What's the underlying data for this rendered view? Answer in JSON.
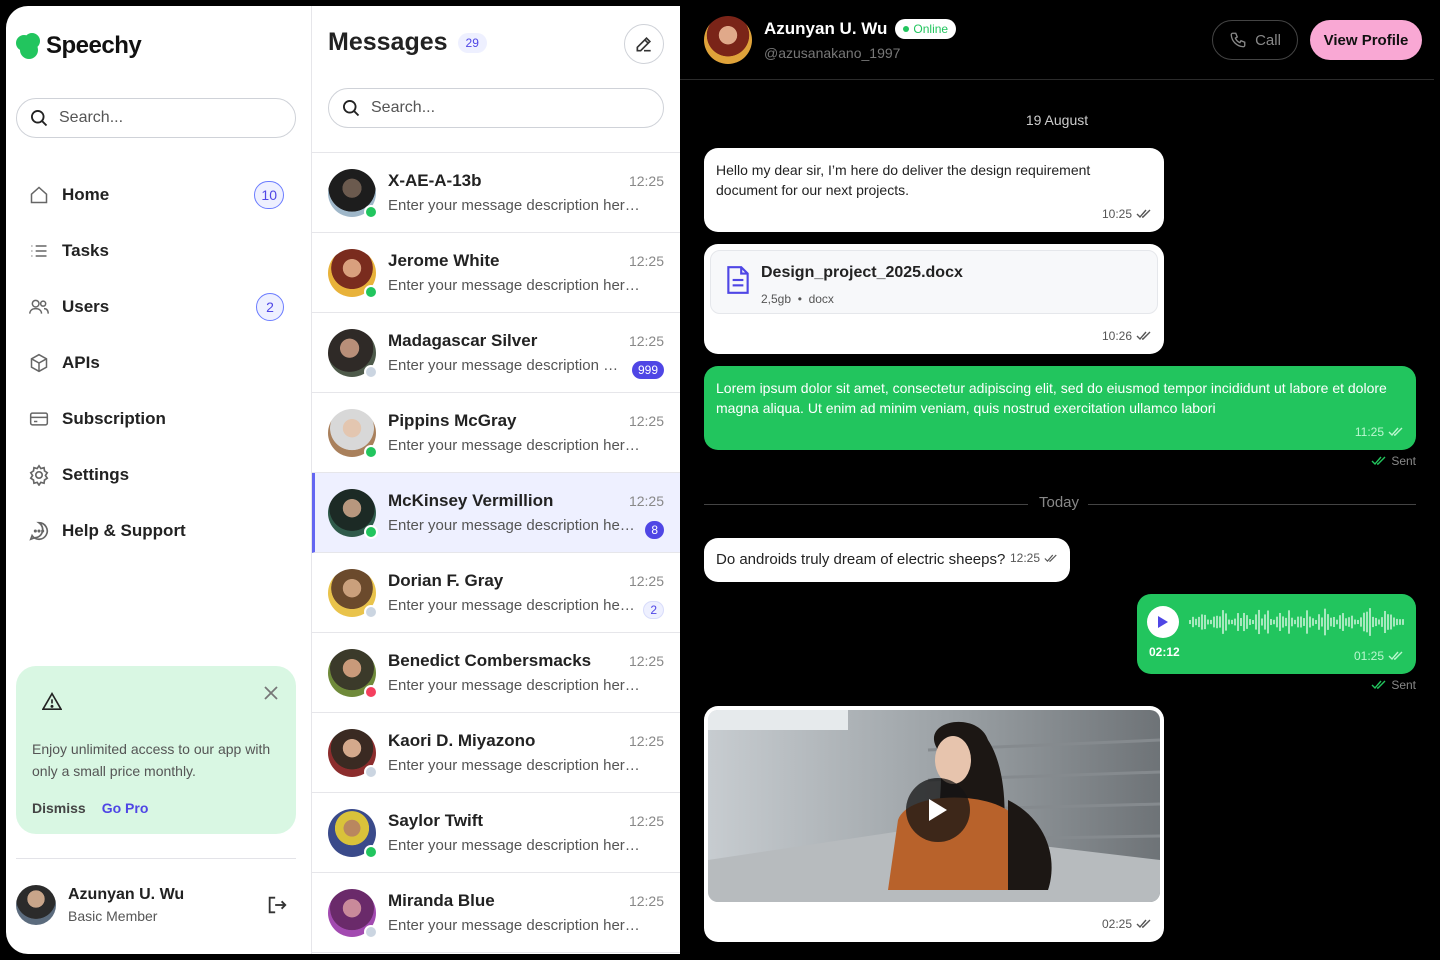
{
  "app": {
    "name": "Speechy"
  },
  "sidebar": {
    "search_placeholder": "Search...",
    "items": [
      {
        "label": "Home",
        "icon": "home-icon",
        "badge": "10"
      },
      {
        "label": "Tasks",
        "icon": "list-icon",
        "badge": null
      },
      {
        "label": "Users",
        "icon": "users-icon",
        "badge": "2"
      },
      {
        "label": "APIs",
        "icon": "cube-icon",
        "badge": null
      },
      {
        "label": "Subscription",
        "icon": "card-icon",
        "badge": null
      },
      {
        "label": "Settings",
        "icon": "gear-icon",
        "badge": null
      },
      {
        "label": "Help & Support",
        "icon": "chat-help-icon",
        "badge": null
      }
    ],
    "promo": {
      "text": "Enjoy unlimited access to our app with only a small price monthly.",
      "dismiss": "Dismiss",
      "go_pro": "Go Pro"
    },
    "user": {
      "name": "Azunyan U. Wu",
      "plan": "Basic Member"
    }
  },
  "messages": {
    "title": "Messages",
    "count": "29",
    "search_placeholder": "Search...",
    "conversations": [
      {
        "name": "X-AE-A-13b",
        "time": "12:25",
        "preview": "Enter your message description here...",
        "unread": null,
        "status": "online"
      },
      {
        "name": "Jerome White",
        "time": "12:25",
        "preview": "Enter your message description here...",
        "unread": null,
        "status": "online"
      },
      {
        "name": "Madagascar Silver",
        "time": "12:25",
        "preview": "Enter your message description here...",
        "unread": "999",
        "status": "offline"
      },
      {
        "name": "Pippins McGray",
        "time": "12:25",
        "preview": "Enter your message description here...",
        "unread": null,
        "status": "online"
      },
      {
        "name": "McKinsey Vermillion",
        "time": "12:25",
        "preview": "Enter your message description here...",
        "unread": "8",
        "status": "online"
      },
      {
        "name": "Dorian F. Gray",
        "time": "12:25",
        "preview": "Enter your message description here...",
        "unread": "2",
        "status": "offline"
      },
      {
        "name": "Benedict Combersmacks",
        "time": "12:25",
        "preview": "Enter your message description here...",
        "unread": null,
        "status": "busy"
      },
      {
        "name": "Kaori D. Miyazono",
        "time": "12:25",
        "preview": "Enter your message description here...",
        "unread": null,
        "status": "offline"
      },
      {
        "name": "Saylor Twift",
        "time": "12:25",
        "preview": "Enter your message description here...",
        "unread": null,
        "status": "online"
      },
      {
        "name": "Miranda Blue",
        "time": "12:25",
        "preview": "Enter your message description here...",
        "unread": null,
        "status": "offline"
      }
    ]
  },
  "chat": {
    "name": "Azunyan U. Wu",
    "status": "Online",
    "handle": "@azusanakano_1997",
    "call_label": "Call",
    "profile_label": "View Profile",
    "date1": "19 August",
    "msg1": {
      "text": "Hello my dear sir, I’m here do deliver the design requirement document for our next projects.",
      "time": "10:25"
    },
    "file": {
      "name": "Design_project_2025.docx",
      "size": "2,5gb",
      "ext": "docx",
      "time": "10:26"
    },
    "msg2": {
      "text": "Lorem ipsum dolor sit amet, consectetur adipiscing elit, sed do eiusmod tempor incididunt ut labore et dolore magna aliqua. Ut enim ad minim veniam, quis nostrud exercitation ullamco labori",
      "time": "11:25",
      "sent": "Sent"
    },
    "today": "Today",
    "msg3": {
      "text": "Do androids truly dream of electric sheeps?",
      "time": "12:25"
    },
    "voice": {
      "duration": "02:12",
      "time": "01:25",
      "sent": "Sent"
    },
    "video": {
      "time": "02:25"
    }
  },
  "colors": {
    "accent": "#4f46e5",
    "green": "#22c55e",
    "pink": "#f9a8d4",
    "promo_bg": "#d9f7e3"
  }
}
